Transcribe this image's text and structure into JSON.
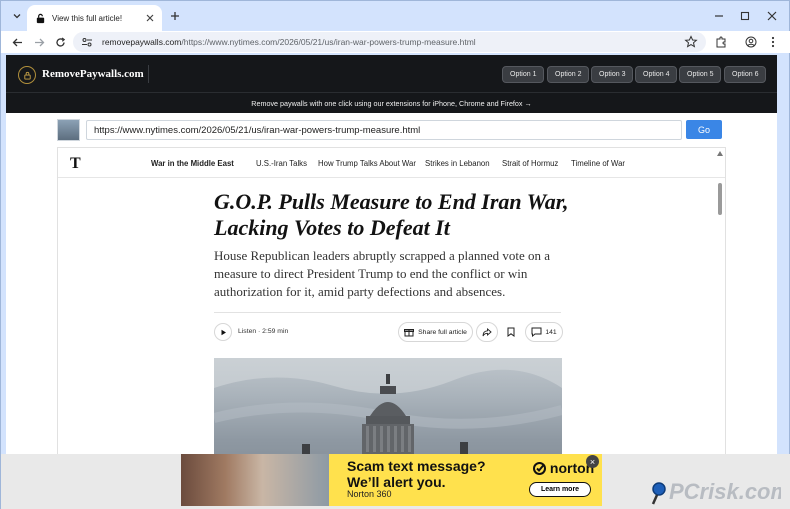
{
  "browser": {
    "tab_title": "View this full article!",
    "url_domain": "removepaywalls.com",
    "url_path": "/https://www.nytimes.com/2026/05/21/us/iran-war-powers-trump-measure.html"
  },
  "site": {
    "logo_text": "RemovePaywalls.com",
    "options": [
      "Option 1",
      "Option 2",
      "Option 3",
      "Option 4",
      "Option 5",
      "Option 6"
    ],
    "banner": "Remove paywalls with one click using our extensions for iPhone, Chrome and Firefox  →",
    "url_value": "https://www.nytimes.com/2026/05/21/us/iran-war-powers-trump-measure.html",
    "go_label": "Go"
  },
  "article": {
    "logo": "T",
    "nav": [
      "War in the Middle East",
      "U.S.-Iran Talks",
      "How Trump Talks About War",
      "Strikes in Lebanon",
      "Strait of Hormuz",
      "Timeline of War"
    ],
    "headline": "G.O.P. Pulls Measure to End Iran War, Lacking Votes to Defeat It",
    "dek": "House Republican leaders abruptly scrapped a planned vote on a measure to direct President Trump to end the conflict or win authorization for it, amid party defections and absences.",
    "listen": "Listen · 2:59 min",
    "share_label": "Share full article",
    "comment_count": "141"
  },
  "ad": {
    "headline_line1": "Scam text message?",
    "headline_line2": "We’ll alert you.",
    "product": "Norton 360",
    "brand": "norton",
    "cta": "Learn more"
  },
  "watermark": {
    "text": "PCrisk.com"
  }
}
